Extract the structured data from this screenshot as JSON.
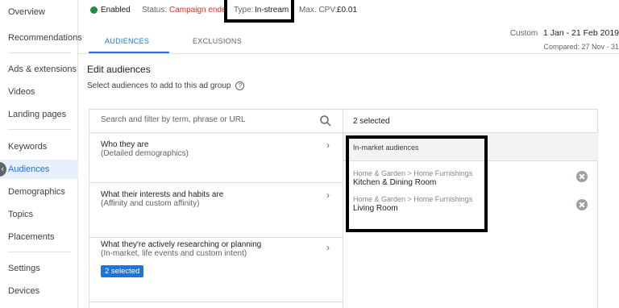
{
  "sidebar": {
    "items": [
      {
        "label": "Overview"
      },
      {
        "label": "Recommendations"
      },
      {
        "label": "Ads & extensions"
      },
      {
        "label": "Videos"
      },
      {
        "label": "Landing pages"
      },
      {
        "label": "Keywords"
      },
      {
        "label": "Audiences"
      },
      {
        "label": "Demographics"
      },
      {
        "label": "Topics"
      },
      {
        "label": "Placements"
      },
      {
        "label": "Settings"
      },
      {
        "label": "Devices"
      }
    ],
    "active": "Audiences"
  },
  "status_bar": {
    "enabled": "Enabled",
    "status_label": "Status:",
    "status_value": "Campaign ended",
    "type_label": "Type:",
    "type_value": "In-stream",
    "max_cpv_label": "Max. CPV:",
    "max_cpv_value": "£0.01"
  },
  "tabs": [
    {
      "label": "AUDIENCES",
      "active": true
    },
    {
      "label": "EXCLUSIONS",
      "active": false
    }
  ],
  "date_range": {
    "preset": "Custom",
    "range": "1 Jan - 21 Feb 2019",
    "compared": "Compared: 27 Nov - 31"
  },
  "main": {
    "title": "Edit audiences",
    "subtitle": "Select audiences to add to this ad group"
  },
  "search": {
    "placeholder": "Search and filter by term, phrase or URL"
  },
  "categories": [
    {
      "title": "Who they are",
      "subtitle": "(Detailed demographics)"
    },
    {
      "title": "What their interests and habits are",
      "subtitle": "(Affinity and custom affinity)"
    },
    {
      "title": "What they're actively researching or planning",
      "subtitle": "(In-market, life events and custom intent)",
      "chip": "2 selected"
    }
  ],
  "selected": {
    "count": "2 selected",
    "group": "In-market audiences",
    "items": [
      {
        "path": "Home & Garden > Home Furnishings",
        "name": "Kitchen & Dining Room"
      },
      {
        "path": "Home & Garden > Home Furnishings",
        "name": "Living Room"
      }
    ]
  },
  "colors": {
    "accent": "#1a73e8",
    "status_ended": "#d93025",
    "enabled_dot": "#1e8e3e",
    "highlight_box": "#000000"
  }
}
